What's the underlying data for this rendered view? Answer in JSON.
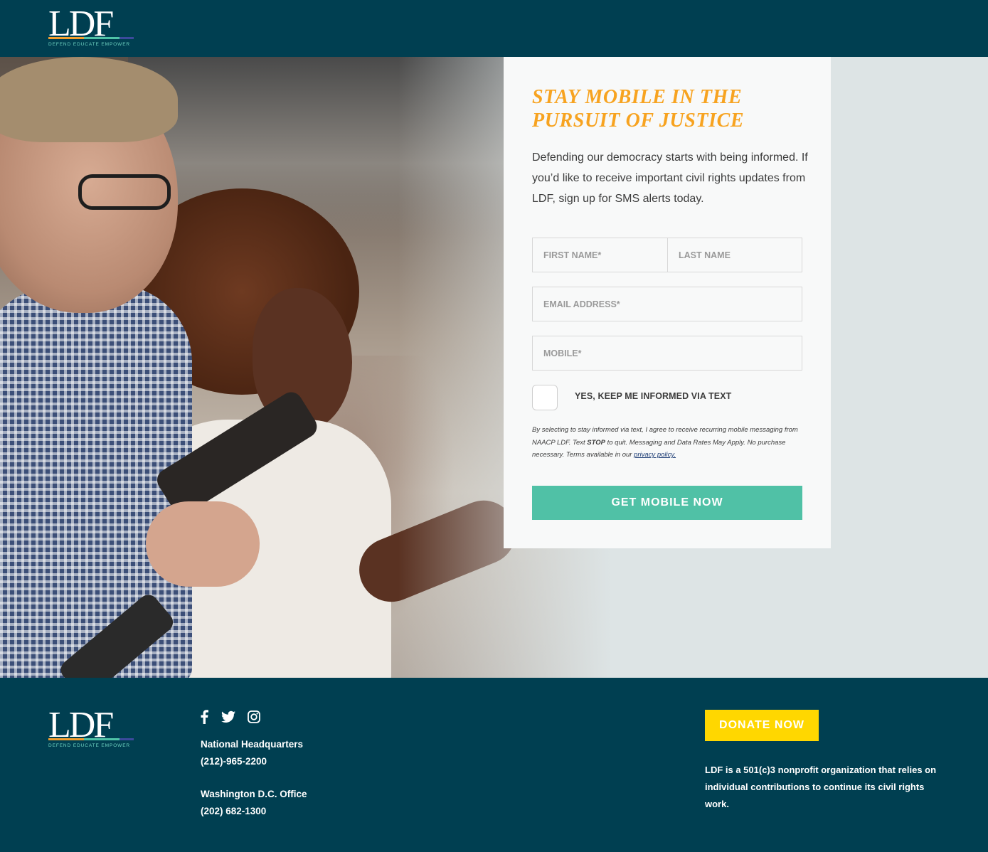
{
  "header": {
    "logo_text": "LDF",
    "logo_tagline": "DEFEND EDUCATE EMPOWER"
  },
  "form": {
    "headline": "STAY MOBILE IN THE PURSUIT OF JUSTICE",
    "intro": "Defending our democracy starts with being informed. If you’d like to receive important civil rights updates from LDF, sign up for SMS alerts today.",
    "first_name_placeholder": "FIRST NAME*",
    "last_name_placeholder": "LAST NAME",
    "email_placeholder": "EMAIL ADDRESS*",
    "mobile_placeholder": "MOBILE*",
    "checkbox_label": "YES, KEEP ME INFORMED VIA TEXT",
    "checkbox_checked": false,
    "legal_before": "By selecting to stay informed via text, I agree to receive recurring mobile messaging from NAACP LDF. Text ",
    "legal_stop": "STOP",
    "legal_after": " to quit. Messaging and Data Rates May Apply. No purchase necessary. Terms available in our ",
    "legal_link": "privacy policy.",
    "submit_label": "GET MOBILE NOW"
  },
  "footer": {
    "logo_text": "LDF",
    "logo_tagline": "DEFEND EDUCATE EMPOWER",
    "social_icons": [
      "facebook-icon",
      "twitter-icon",
      "instagram-icon"
    ],
    "hq_label": "National Headquarters",
    "hq_phone": "(212)-965-2200",
    "dc_label": "Washington D.C. Office",
    "dc_phone": "(202) 682-1300",
    "donate_label": "DONATE NOW",
    "nonprofit_text": "LDF is a 501(c)3 nonprofit organization that relies on individual contributions to continue its civil rights work."
  },
  "colors": {
    "navy": "#003f51",
    "headline_orange": "#f7a320",
    "button_teal": "#50c1a6",
    "donate_yellow": "#ffd700",
    "logo_bar_orange": "#f29f2e",
    "logo_bar_teal": "#4fc3a7",
    "logo_bar_blue": "#3b4a9c"
  }
}
